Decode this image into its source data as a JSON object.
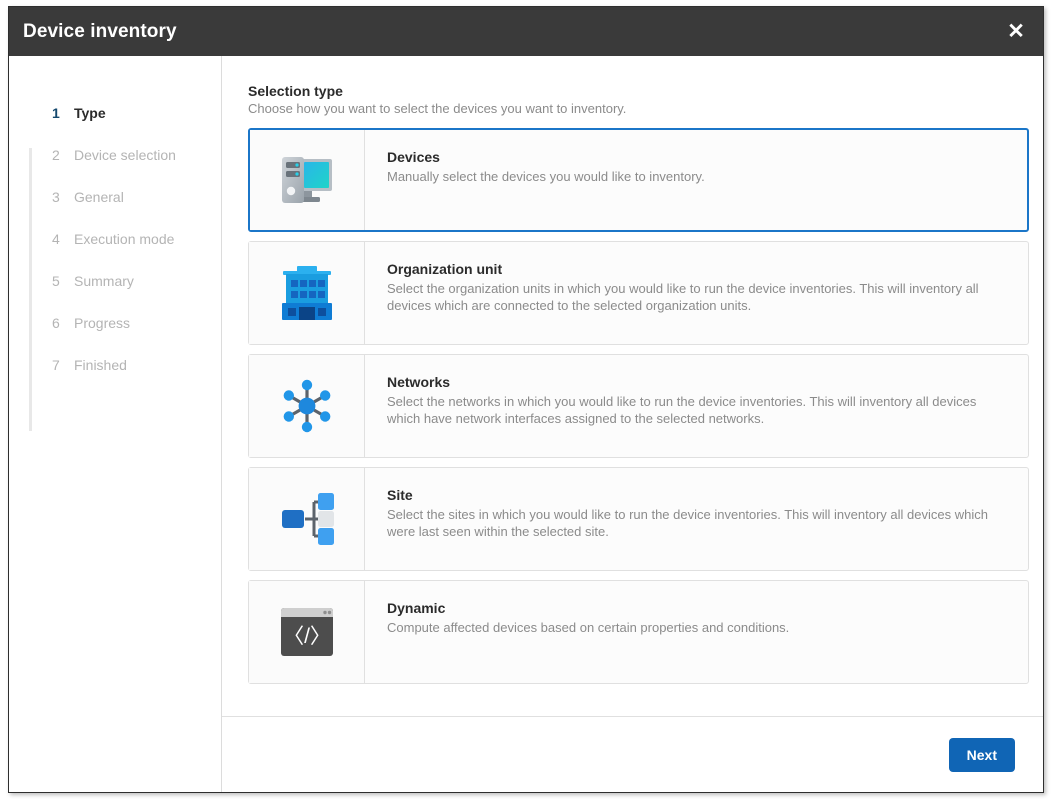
{
  "window": {
    "title": "Device inventory",
    "close_label": "✕",
    "close_icon": "close-icon"
  },
  "sidebar": {
    "steps": [
      {
        "num": "1",
        "label": "Type",
        "active": true
      },
      {
        "num": "2",
        "label": "Device selection",
        "active": false
      },
      {
        "num": "3",
        "label": "General",
        "active": false
      },
      {
        "num": "4",
        "label": "Execution mode",
        "active": false
      },
      {
        "num": "5",
        "label": "Summary",
        "active": false
      },
      {
        "num": "6",
        "label": "Progress",
        "active": false
      },
      {
        "num": "7",
        "label": "Finished",
        "active": false
      }
    ]
  },
  "main": {
    "section_title": "Selection type",
    "section_subtitle": "Choose how you want to select the devices you want to inventory.",
    "options": [
      {
        "title": "Devices",
        "desc": "Manually select the devices you would like to inventory.",
        "icon": "desktop-computer-icon",
        "selected": true
      },
      {
        "title": "Organization unit",
        "desc": "Select the organization units in which you would like to run the device inventories. This will inventory all devices which are connected to the selected organization units.",
        "icon": "office-building-icon",
        "selected": false
      },
      {
        "title": "Networks",
        "desc": "Select the networks in which you would like to run the device inventories. This will inventory all devices which have network interfaces assigned to the selected networks.",
        "icon": "network-hub-icon",
        "selected": false
      },
      {
        "title": "Site",
        "desc": "Select the sites in which you would like to run the device inventories. This will inventory all devices which were last seen within the selected site.",
        "icon": "sitemap-icon",
        "selected": false
      },
      {
        "title": "Dynamic",
        "desc": "Compute affected devices based on certain properties and conditions.",
        "icon": "code-window-icon",
        "selected": false
      }
    ]
  },
  "footer": {
    "next_label": "Next"
  },
  "colors": {
    "header_bg": "#3a3a3a",
    "accent_blue": "#1065b5",
    "selected_border": "#1b76c8",
    "icon_blue": "#1e9ae0",
    "icon_blue_dark": "#1565c0",
    "muted_text": "#8b8b8b"
  }
}
